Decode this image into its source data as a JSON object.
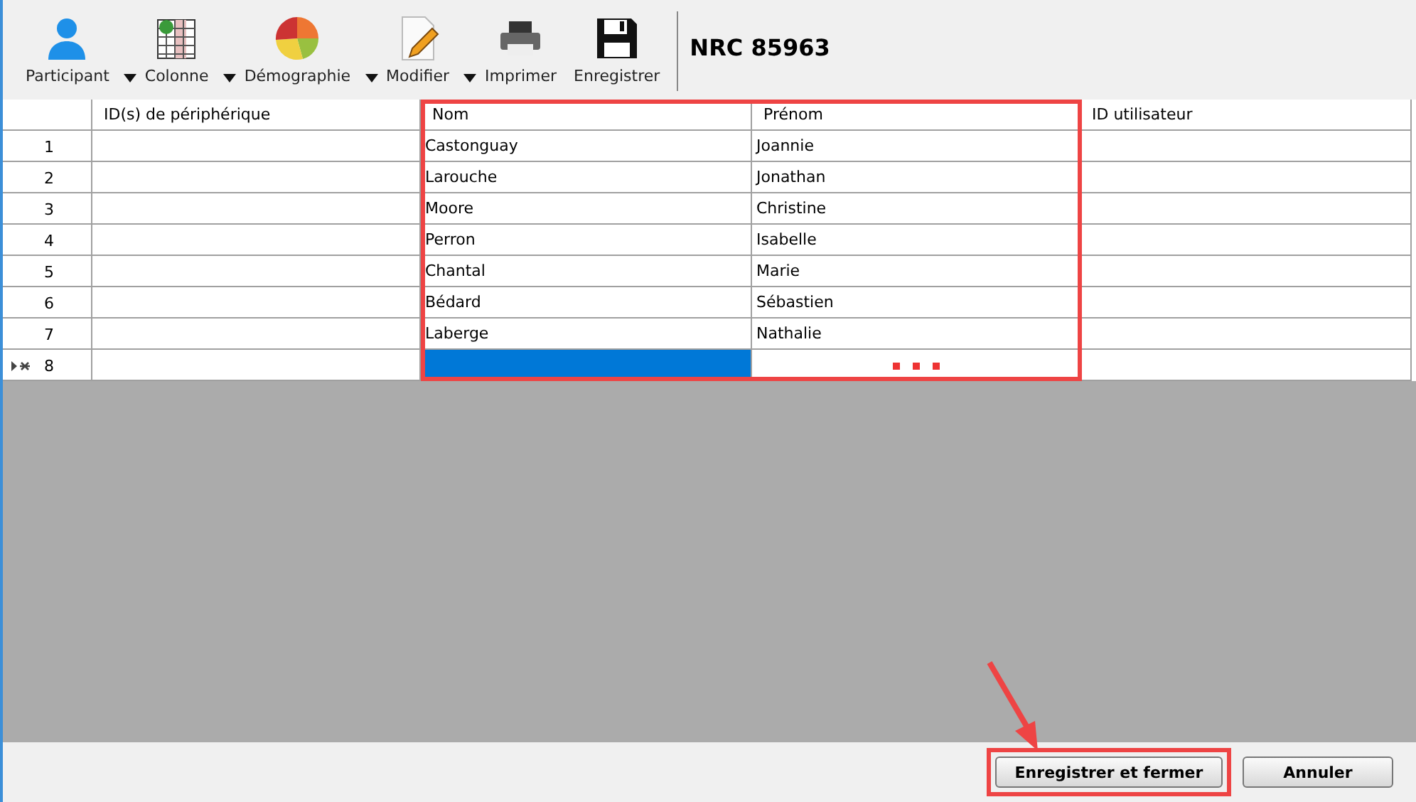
{
  "toolbar": {
    "items": [
      {
        "label": "Participant",
        "has_menu": true
      },
      {
        "label": "Colonne",
        "has_menu": true
      },
      {
        "label": "Démographie",
        "has_menu": true
      },
      {
        "label": "Modifier",
        "has_menu": true
      },
      {
        "label": "Imprimer",
        "has_menu": false
      },
      {
        "label": "Enregistrer",
        "has_menu": false
      }
    ],
    "title": "NRC 85963"
  },
  "table": {
    "columns": [
      "ID(s) de périphérique",
      "Nom",
      "Prénom",
      "ID utilisateur"
    ],
    "rows": [
      {
        "number": "1",
        "nom": "Castonguay",
        "prenom": "Joannie",
        "new": false,
        "selected": false
      },
      {
        "number": "2",
        "nom": "Larouche",
        "prenom": "Jonathan",
        "new": false,
        "selected": false
      },
      {
        "number": "3",
        "nom": "Moore",
        "prenom": "Christine",
        "new": false,
        "selected": false
      },
      {
        "number": "4",
        "nom": "Perron",
        "prenom": "Isabelle",
        "new": false,
        "selected": false
      },
      {
        "number": "5",
        "nom": "Chantal",
        "prenom": "Marie",
        "new": false,
        "selected": false
      },
      {
        "number": "6",
        "nom": "Bédard",
        "prenom": "Sébastien",
        "new": false,
        "selected": false
      },
      {
        "number": "7",
        "nom": "Laberge",
        "prenom": "Nathalie",
        "new": false,
        "selected": false
      },
      {
        "number": "8",
        "nom": "",
        "prenom": "",
        "new": true,
        "selected": true
      }
    ]
  },
  "buttons": [
    {
      "label": "Enregistrer et fermer",
      "highlighted": true
    },
    {
      "label": "Annuler",
      "highlighted": false
    }
  ]
}
